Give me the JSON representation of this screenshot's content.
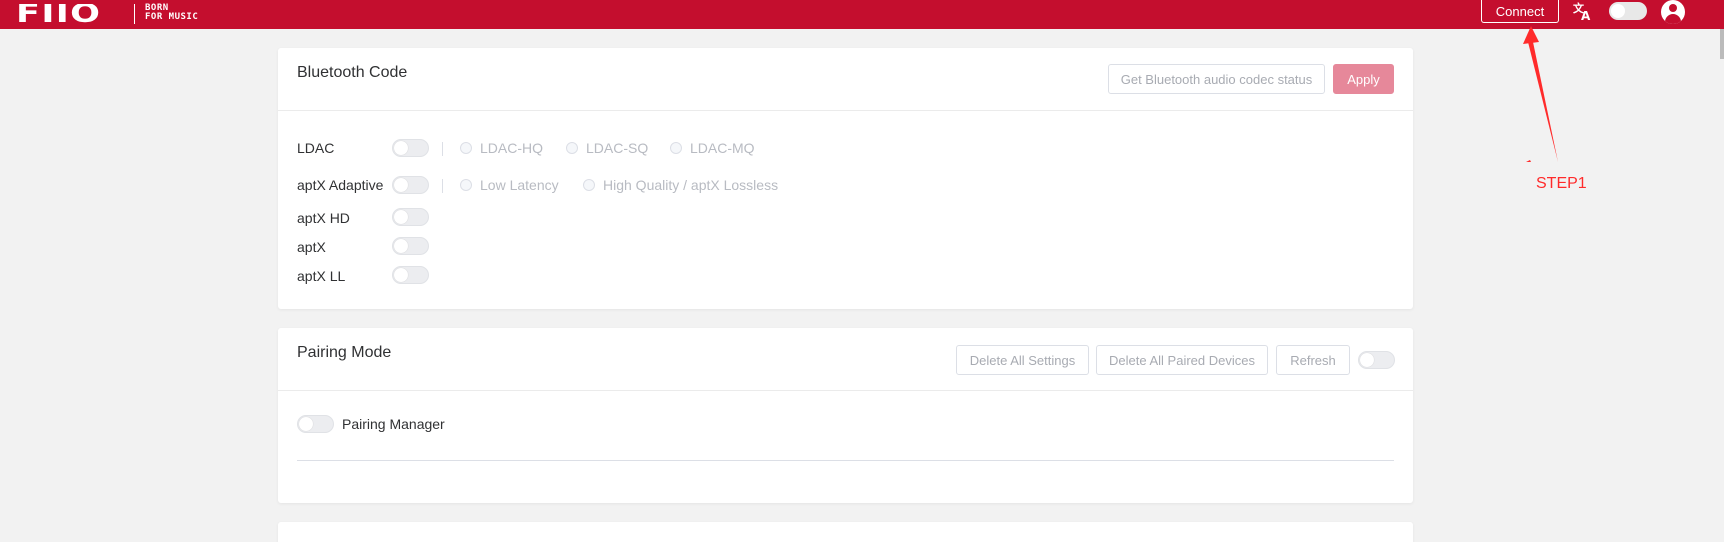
{
  "header": {
    "logo_text": "FIIO",
    "logo_tagline_line1": "BORN",
    "logo_tagline_line2": "FOR MUSIC",
    "connect_label": "Connect",
    "language_icon": "translate-icon",
    "theme_toggle_icon": "toggle-switch",
    "avatar_icon": "user-avatar-icon",
    "brand_color": "#c40e2e"
  },
  "bluetooth_card": {
    "title": "Bluetooth Code",
    "get_status_label": "Get Bluetooth audio codec status",
    "apply_label": "Apply",
    "codecs": [
      {
        "label": "LDAC",
        "enabled": false,
        "options": [
          "LDAC-HQ",
          "LDAC-SQ",
          "LDAC-MQ"
        ]
      },
      {
        "label": "aptX Adaptive",
        "enabled": false,
        "options": [
          "Low Latency",
          "High Quality / aptX Lossless"
        ]
      },
      {
        "label": "aptX HD",
        "enabled": false
      },
      {
        "label": "aptX",
        "enabled": false
      },
      {
        "label": "aptX LL",
        "enabled": false
      }
    ]
  },
  "pairing_card": {
    "title": "Pairing Mode",
    "delete_settings_label": "Delete All Settings",
    "delete_devices_label": "Delete All Paired Devices",
    "refresh_label": "Refresh",
    "pairing_manager_label": "Pairing Manager",
    "pairing_manager_enabled": false
  },
  "annotation": {
    "step_label": "STEP1",
    "color": "#ff2b2b"
  }
}
